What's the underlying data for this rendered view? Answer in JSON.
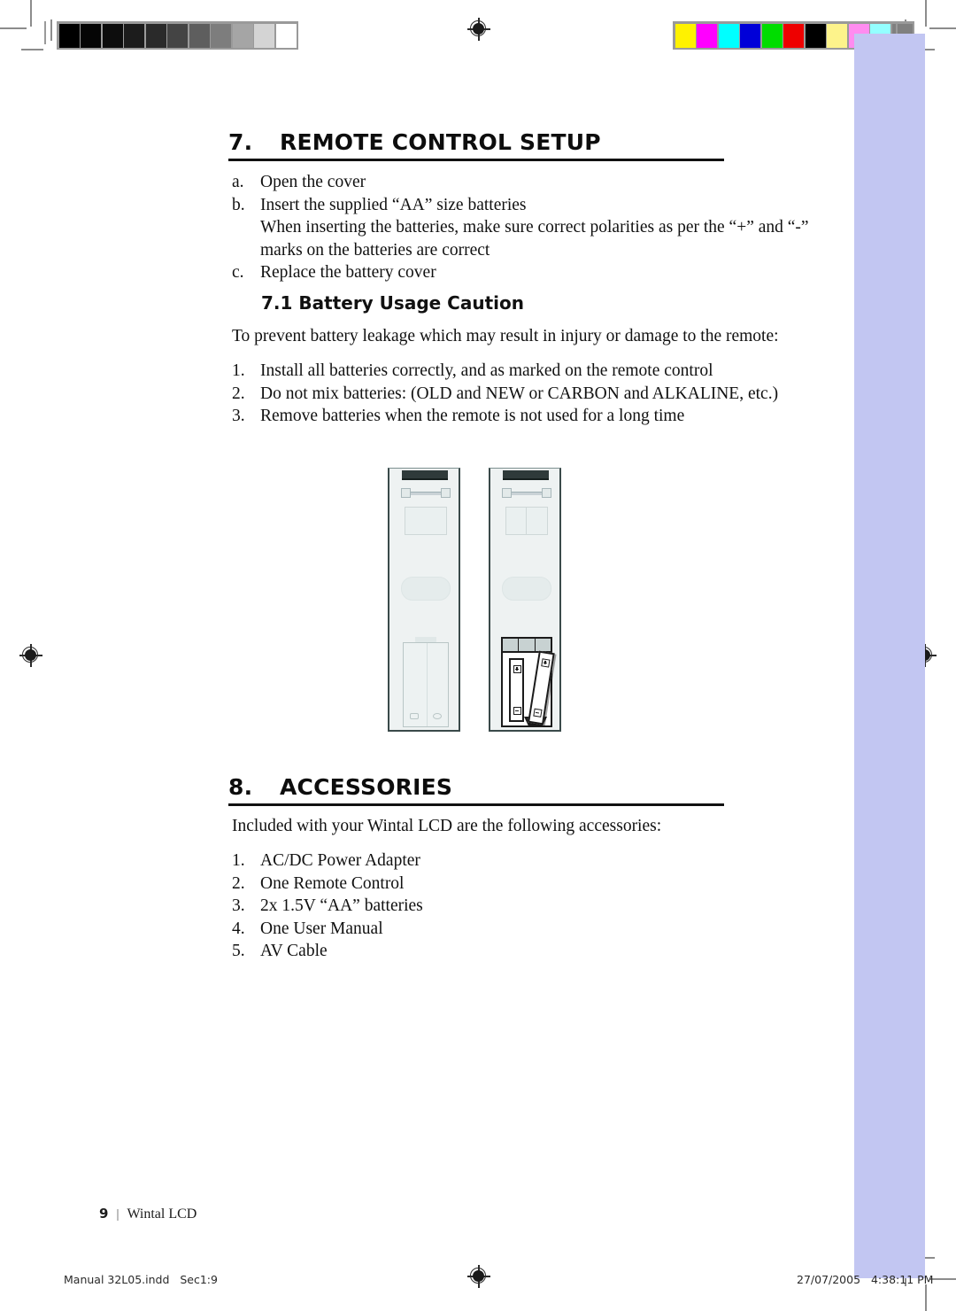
{
  "document": {
    "footer_page_number": "9",
    "footer_divider": "|",
    "footer_doc_title": "Wintal LCD",
    "slug_left": "Manual 32L05.indd   Sec1:9",
    "slug_right": "27/07/2005   4:38:11 PM"
  },
  "sections": [
    {
      "number": "7.",
      "title": "REMOTE CONTROL SETUP",
      "items": [
        {
          "marker": "a.",
          "text": "Open the cover"
        },
        {
          "marker": "b.",
          "text": "Insert the supplied “AA” size batteries"
        },
        {
          "marker": "",
          "text": "When inserting the batteries, make sure correct polarities as per the “+” and “-”"
        },
        {
          "marker": "",
          "text": "marks on the batteries are correct"
        },
        {
          "marker": "c.",
          "text": "Replace the battery cover"
        }
      ]
    },
    {
      "number": "8.",
      "title": "ACCESSORIES",
      "intro": "Included with your Wintal LCD are the following accessories:",
      "items": [
        {
          "marker": "1.",
          "text": "AC/DC Power Adapter"
        },
        {
          "marker": "2.",
          "text": "One Remote Control"
        },
        {
          "marker": "3.",
          "text": "2x 1.5V “AA” batteries"
        },
        {
          "marker": "4.",
          "text": "One User Manual"
        },
        {
          "marker": "5.",
          "text": "AV Cable"
        }
      ]
    }
  ],
  "subsection": {
    "number_title": "7.1 Battery Usage Caution",
    "intro": "To prevent battery leakage which may result in injury or damage to the remote:",
    "items": [
      {
        "marker": "1.",
        "text": "Install all batteries correctly, and as marked on the remote control"
      },
      {
        "marker": "2.",
        "text": "Do not mix batteries: (OLD and NEW or CARBON and ALKALINE, etc.)"
      },
      {
        "marker": "3.",
        "text": "Remove batteries when the remote is not used for a long time"
      }
    ]
  },
  "figure": {
    "caption": "",
    "left_remote_label": "remote back with battery cover closed",
    "right_remote_label": "remote back with battery cover open showing AA batteries"
  },
  "prepress": {
    "grayscale_patches": [
      "#000000",
      "#050505",
      "#0d0d0d",
      "#1c1c1c",
      "#2a2a2a",
      "#444444",
      "#5e5e5e",
      "#7d7d7d",
      "#a5a5a5",
      "#d4d4d4",
      "#ffffff"
    ],
    "color_patches": [
      "#fff200",
      "#ff00ff",
      "#00ffff",
      "#0000d8",
      "#00dd00",
      "#ee0000",
      "#000000",
      "#fdf38b",
      "#ff8cf0",
      "#94ffff",
      "#808080"
    ],
    "bleed_band_color": "#c2c6f2",
    "crop_mark_color": "#8c8c8c"
  }
}
